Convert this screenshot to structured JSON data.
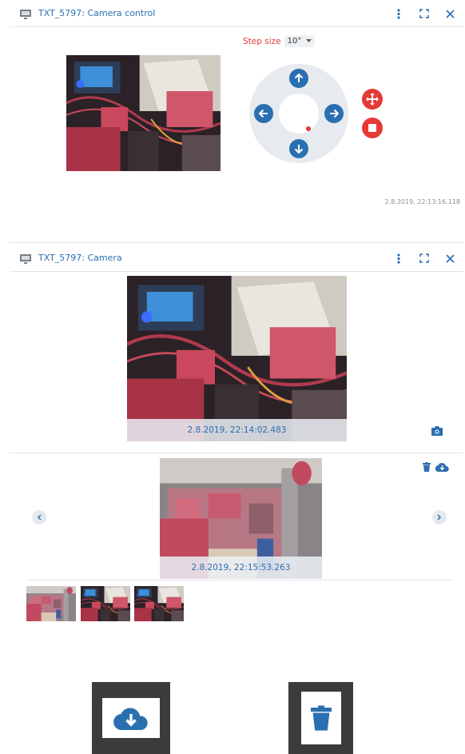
{
  "panel1": {
    "title": "TXT_5797: Camera control",
    "step_label": "Step size",
    "step_value": "10°",
    "timestamp": "2.8.2019, 22:13:16.118"
  },
  "panel2": {
    "title": "TXT_5797: Camera",
    "live_timestamp": "2.8.2019, 22:14:02.483",
    "gallery_timestamp": "2.8.2019, 22:15:53.263"
  },
  "icons": {
    "monitor": "monitor-icon",
    "more": "more-vertical-icon",
    "fullscreen": "fullscreen-icon",
    "close": "close-icon",
    "up": "arrow-up-icon",
    "down": "arrow-down-icon",
    "left": "arrow-left-icon",
    "right": "arrow-right-icon",
    "move": "move-icon",
    "stop": "stop-icon",
    "camera": "camera-icon",
    "trash": "trash-icon",
    "cloud_download": "cloud-download-icon"
  },
  "colors": {
    "accent": "#2a6fb0",
    "danger": "#e53935",
    "header_border": "#dfe5ec"
  }
}
